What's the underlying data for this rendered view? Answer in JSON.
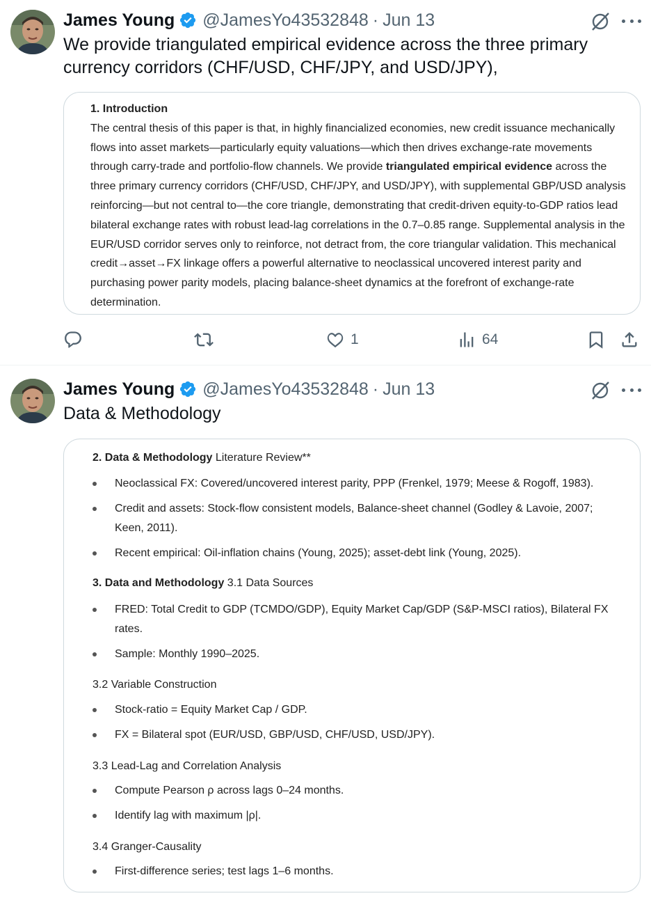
{
  "tweets": [
    {
      "author": "James Young",
      "handle": "@JamesYo43532848",
      "date": "Jun 13",
      "text": "We provide triangulated empirical evidence across the three primary currency corridors (CHF/USD, CHF/JPY, and USD/JPY),",
      "card": {
        "heading": "1. Introduction",
        "body_pre": "The central thesis of this paper is that, in highly financialized economies, new credit issuance mechanically flows into asset markets—particularly equity valuations—which then drives exchange-rate movements through carry-trade and portfolio-flow channels. We provide ",
        "body_bold": "triangulated empirical evidence",
        "body_post": " across the three primary currency corridors (CHF/USD, CHF/JPY, and USD/JPY), with supplemental GBP/USD analysis reinforcing—but not central to—the core triangle, demonstrating that credit-driven equity-to-GDP ratios lead bilateral exchange rates with robust lead-lag correlations in the 0.7–0.85 range. Supplemental analysis in the EUR/USD corridor serves only to reinforce, not detract from, the core triangular validation. This mechanical credit→asset→FX linkage offers a powerful alternative to neoclassical uncovered interest parity and purchasing power parity models, placing balance-sheet dynamics at the forefront of exchange-rate determination."
      },
      "actions": {
        "likes": "1",
        "views": "64"
      }
    },
    {
      "author": "James Young",
      "handle": "@JamesYo43532848",
      "date": "Jun 13",
      "text": "Data & Methodology",
      "card": {
        "s2_bold": "2. Data & Methodology",
        "s2_rest": " Literature Review**",
        "s2_items": [
          "Neoclassical FX: Covered/uncovered interest parity, PPP (Frenkel, 1979; Meese & Rogoff, 1983).",
          "Credit and assets: Stock-flow consistent models, Balance-sheet channel (Godley & Lavoie, 2007; Keen, 2011).",
          "Recent empirical: Oil-inflation chains (Young, 2025); asset-debt link (Young, 2025)."
        ],
        "s3_bold": "3. Data and Methodology",
        "s3_rest": " 3.1 Data Sources",
        "s31_items": [
          "FRED: Total Credit to GDP (TCMDO/GDP), Equity Market Cap/GDP (S&P-MSCI ratios), Bilateral FX rates.",
          "Sample: Monthly 1990–2025."
        ],
        "s32_title": "3.2 Variable Construction",
        "s32_items": [
          "Stock-ratio = Equity Market Cap / GDP.",
          "FX = Bilateral spot (EUR/USD, GBP/USD, CHF/USD, USD/JPY)."
        ],
        "s33_title": "3.3 Lead-Lag and Correlation Analysis",
        "s33_items": [
          "Compute Pearson ρ across lags 0–24 months.",
          "Identify lag with maximum |ρ|."
        ],
        "s34_title": "3.4 Granger-Causality",
        "s34_items": [
          "First-difference series; test lags 1–6 months."
        ]
      }
    }
  ],
  "colors": {
    "verified": "#1d9bf0",
    "muted": "#536471",
    "border": "#cfd9de"
  },
  "icons": [
    "verified-badge-icon",
    "grok-icon",
    "more-icon",
    "reply-icon",
    "retweet-icon",
    "like-icon",
    "views-icon",
    "bookmark-icon",
    "share-icon"
  ]
}
